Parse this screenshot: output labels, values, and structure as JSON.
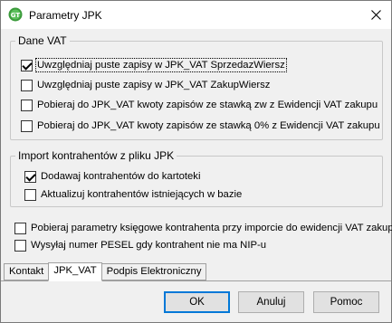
{
  "window": {
    "title": "Parametry JPK",
    "close_glyph": "✕",
    "app_icon": "jpk-app-icon"
  },
  "group_vat": {
    "legend": "Dane VAT",
    "items": [
      {
        "label": "Uwzględniaj puste zapisy w JPK_VAT SprzedazWiersz",
        "checked": true
      },
      {
        "label": "Uwzględniaj puste zapisy w JPK_VAT ZakupWiersz",
        "checked": false
      },
      {
        "label": "Pobieraj do JPK_VAT kwoty zapisów ze stawką zw z Ewidencji VAT zakupu",
        "checked": false
      },
      {
        "label": "Pobieraj do JPK_VAT kwoty zapisów ze stawką 0% z Ewidencji VAT zakupu",
        "checked": false
      }
    ]
  },
  "group_import": {
    "legend": "Import kontrahentów z pliku JPK",
    "items": [
      {
        "label": "Dodawaj kontrahentów do kartoteki",
        "checked": true
      },
      {
        "label": "Aktualizuj kontrahentów istniejących w bazie",
        "checked": false
      }
    ]
  },
  "extra_options": [
    {
      "label": "Pobieraj parametry księgowe kontrahenta przy imporcie do ewidencji VAT zakupu",
      "checked": false
    },
    {
      "label": "Wysyłaj numer PESEL gdy kontrahent nie ma NIP-u",
      "checked": false
    }
  ],
  "tabs": [
    {
      "label": "Kontakt",
      "active": false
    },
    {
      "label": "JPK_VAT",
      "active": true
    },
    {
      "label": "Podpis Elektroniczny",
      "active": false
    }
  ],
  "buttons": {
    "ok": "OK",
    "cancel": "Anuluj",
    "help": "Pomoc"
  }
}
